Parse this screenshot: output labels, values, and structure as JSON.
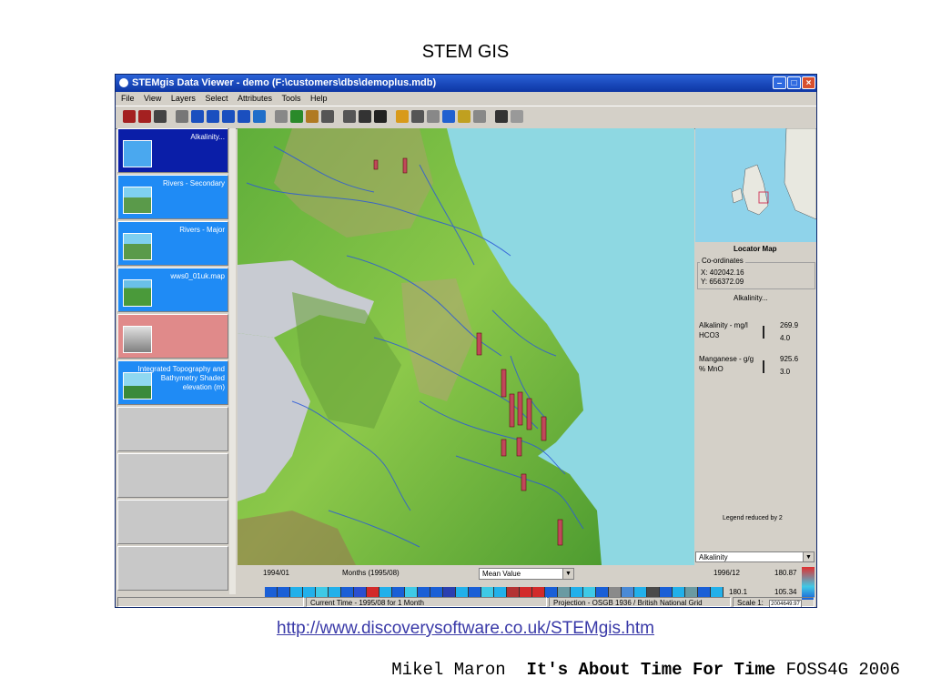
{
  "slide": {
    "title": "STEM GIS",
    "link": "http://www.discoverysoftware.co.uk/STEMgis.htm",
    "author": "Mikel Maron",
    "talk_title": "It's About Time For Time",
    "event": "FOSS4G 2006"
  },
  "window": {
    "title": "STEMgis Data Viewer - demo (F:\\customers\\dbs\\demoplus.mdb)",
    "controls": [
      "minimize-icon",
      "maximize-icon",
      "close-icon"
    ]
  },
  "menu": [
    "File",
    "View",
    "Layers",
    "Select",
    "Attributes",
    "Tools",
    "Help"
  ],
  "toolbar": {
    "icons": [
      "open-icon",
      "save-icon",
      "print-icon",
      "pan-hand-icon",
      "zoom-in-icon",
      "zoom-out-icon",
      "zoom-extent-icon",
      "zoom-previous-icon",
      "globe-icon",
      "layer-icon",
      "map-icon",
      "table-icon",
      "select-arrow-icon",
      "select-box-icon",
      "identify-icon",
      "sum-icon",
      "bar-chart-icon",
      "camera-icon",
      "record-icon",
      "add-point-icon",
      "legend-icon",
      "grid-icon",
      "pen-icon",
      "export-icon"
    ]
  },
  "layers": [
    {
      "label": "Alkalinity...",
      "style": "sel",
      "icon": "flask-icon"
    },
    {
      "label": "Rivers - Secondary",
      "style": "blue",
      "icon": "landscape-icon"
    },
    {
      "label": "Rivers - Major",
      "style": "blue",
      "icon": "landscape-icon"
    },
    {
      "label": "wws0_01uk.map",
      "style": "blue",
      "icon": "terrain-icon"
    },
    {
      "label": "",
      "style": "pink",
      "icon": "grayscale-map-icon"
    },
    {
      "label": "Integrated Topography and Bathymetry Shaded elevation (m)",
      "style": "blue",
      "icon": "tree-icon"
    },
    {
      "label": "",
      "style": "empty",
      "icon": ""
    },
    {
      "label": "",
      "style": "empty",
      "icon": ""
    },
    {
      "label": "",
      "style": "empty",
      "icon": ""
    },
    {
      "label": "",
      "style": "empty",
      "icon": ""
    }
  ],
  "right_panel": {
    "locator_title": "Locator Map",
    "coords_heading": "Co-ordinates",
    "x_label": "X: 402042.16",
    "y_label": "Y: 656372.09",
    "layer_name": "Alkalinity...",
    "attr1_name": "Alkalinity - mg/l",
    "attr1_unit": "HCO3",
    "attr1_max": "269.9",
    "attr1_min": "4.0",
    "attr2_name": "Manganese - g/g",
    "attr2_unit": "% MnO",
    "attr2_max": "925.6",
    "attr2_min": "3.0",
    "legend_note": "Legend reduced by 2",
    "layer_select": "Alkalinity"
  },
  "timebar": {
    "start": "1994/01",
    "months_label": "Months (1995/08)",
    "mode_select": "Mean Value",
    "end": "1996/12",
    "val_top": "180.87",
    "val_mid": "180.1",
    "val_right": "105.34",
    "swatch_colors": [
      "#1a5fd6",
      "#1a5fd6",
      "#22b0ea",
      "#22b0ea",
      "#3fc9e6",
      "#22b0ea",
      "#1a5fd6",
      "#2a4fd0",
      "#d22a2a",
      "#22b0ea",
      "#1a5fd6",
      "#3fc9e6",
      "#1a5fd6",
      "#1a5fd6",
      "#2a3fb0",
      "#22b0ea",
      "#1a5fd6",
      "#3fc9e6",
      "#22b0ea",
      "#b33333",
      "#d22a2a",
      "#d22a2a",
      "#1a5fd6",
      "#6a9aa2",
      "#22b0ea",
      "#3fc9e6",
      "#1a5fd6",
      "#8a8a8a",
      "#4a8ad6",
      "#22b0ea",
      "#4a4a4a",
      "#1a5fd6",
      "#22b0ea",
      "#6a9aa2",
      "#1a5fd6",
      "#22b0ea"
    ]
  },
  "status": {
    "current_time": "Current Time - 1995/08 for 1 Month",
    "projection": "Projection - OSGB 1936 / British National Grid",
    "scale_label": "Scale 1:",
    "scale_value": "2004649.97"
  }
}
